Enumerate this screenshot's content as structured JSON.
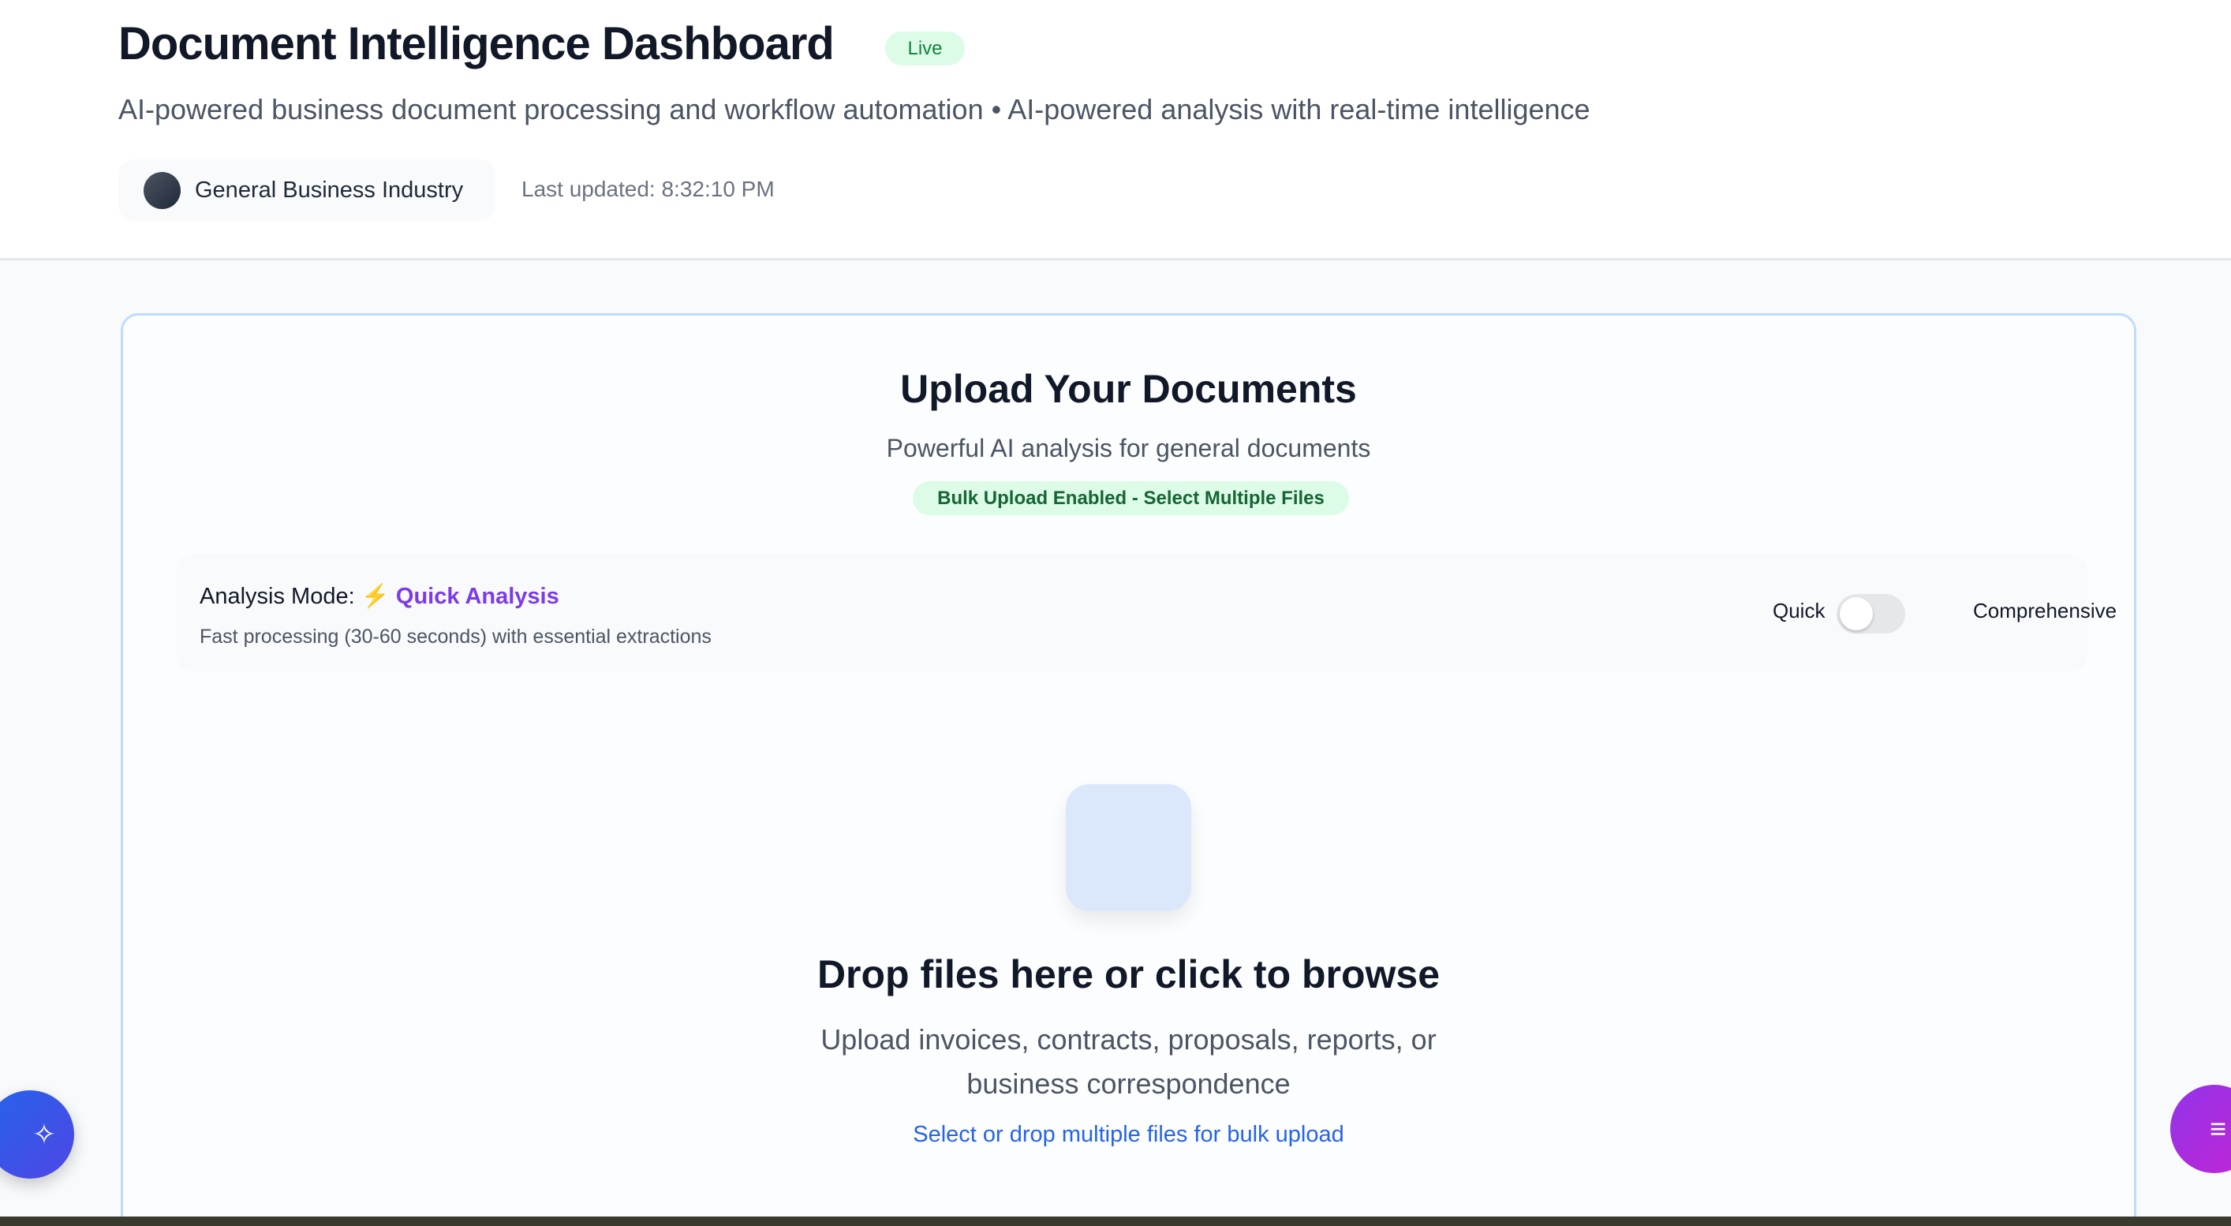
{
  "header": {
    "title": "Document Intelligence Dashboard",
    "status_badge": "Live",
    "subtitle": "AI-powered business document processing and workflow automation • AI-powered analysis with real-time intelligence",
    "industry": "General Business Industry",
    "last_updated": "Last updated: 8:32:10 PM"
  },
  "upload": {
    "title": "Upload Your Documents",
    "subtitle": "Powerful AI analysis for general documents",
    "bulk_badge": "Bulk Upload Enabled - Select Multiple Files",
    "mode": {
      "label": "Analysis Mode:",
      "icon": "⚡",
      "value": "Quick Analysis",
      "description": "Fast processing (30-60 seconds) with essential extractions",
      "toggle_left": "Quick",
      "toggle_right": "Comprehensive",
      "toggle_on": false
    },
    "drop_title": "Drop files here or click to browse",
    "drop_description": "Upload invoices, contracts, proposals, reports, or business correspondence",
    "drop_link": "Select or drop multiple files for bulk upload"
  },
  "fabs": {
    "left_icon": "sparkles-icon",
    "right_icon": "menu-icon"
  },
  "colors": {
    "accent": "#7c3aed",
    "link": "#2563eb",
    "live": "#15803d",
    "card_border": "#bfdbfe"
  }
}
